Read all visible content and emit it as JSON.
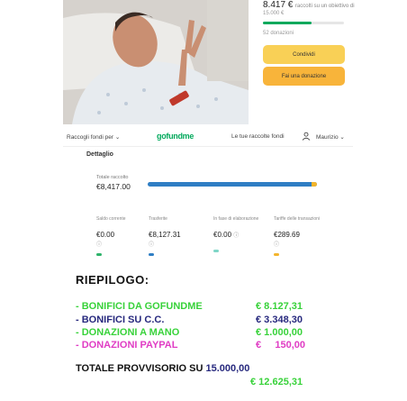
{
  "campaign": {
    "amount_raised": "8.417 €",
    "amount_goal_text": "raccolti su un obiettivo di",
    "amount_goal_sub": "15.000 €",
    "donors_count": "52 donazioni",
    "share_label": "Condividi",
    "donate_label": "Fai una donazione"
  },
  "navbar": {
    "left_menu": "Raccogli fondi per",
    "logo": "gofundme",
    "mid_menu": "Le tue raccolte fondi",
    "user_name": "Maurizio"
  },
  "dettaglio": {
    "title": "Dettaglio",
    "total_label": "Totale raccolto",
    "total_value": "€8,417.00",
    "bar_fill_fraction": 0.966,
    "columns": [
      {
        "label": "Saldo corrente",
        "value": "€0.00",
        "color": "#2fb36b"
      },
      {
        "label": "Trasferite",
        "value": "€8,127.31",
        "color": "#2f7ec4"
      },
      {
        "label": "In fase di elaborazione",
        "value": "€0.00",
        "color": "#7fd6c7"
      },
      {
        "label": "Tariffe delle transazioni",
        "value": "€289.69",
        "color": "#f3b42c"
      }
    ]
  },
  "riepilogo": {
    "title": "RIEPILOGO:",
    "rows": [
      {
        "label": "- BONIFICI DA GOFUNDME",
        "amount": "€ 8.127,31"
      },
      {
        "label": "- BONIFICI SU C.C.",
        "amount": "€ 3.348,30"
      },
      {
        "label": "- DONAZIONI A MANO",
        "amount": "€ 1.000,00"
      },
      {
        "label": "- DONAZIONI PAYPAL",
        "amount": "€     150,00"
      }
    ],
    "total_prefix": "TOTALE PROVVISORIO SU ",
    "total_target": "15.000,00",
    "total_raised": "€ 12.625,31"
  },
  "colors": {
    "brand_green": "#02a95c",
    "share_yellow": "#f9d056",
    "donate_orange": "#f8b43a",
    "row_green": "#38d23a",
    "row_navy": "#27297e",
    "row_magenta": "#e03cc4"
  }
}
